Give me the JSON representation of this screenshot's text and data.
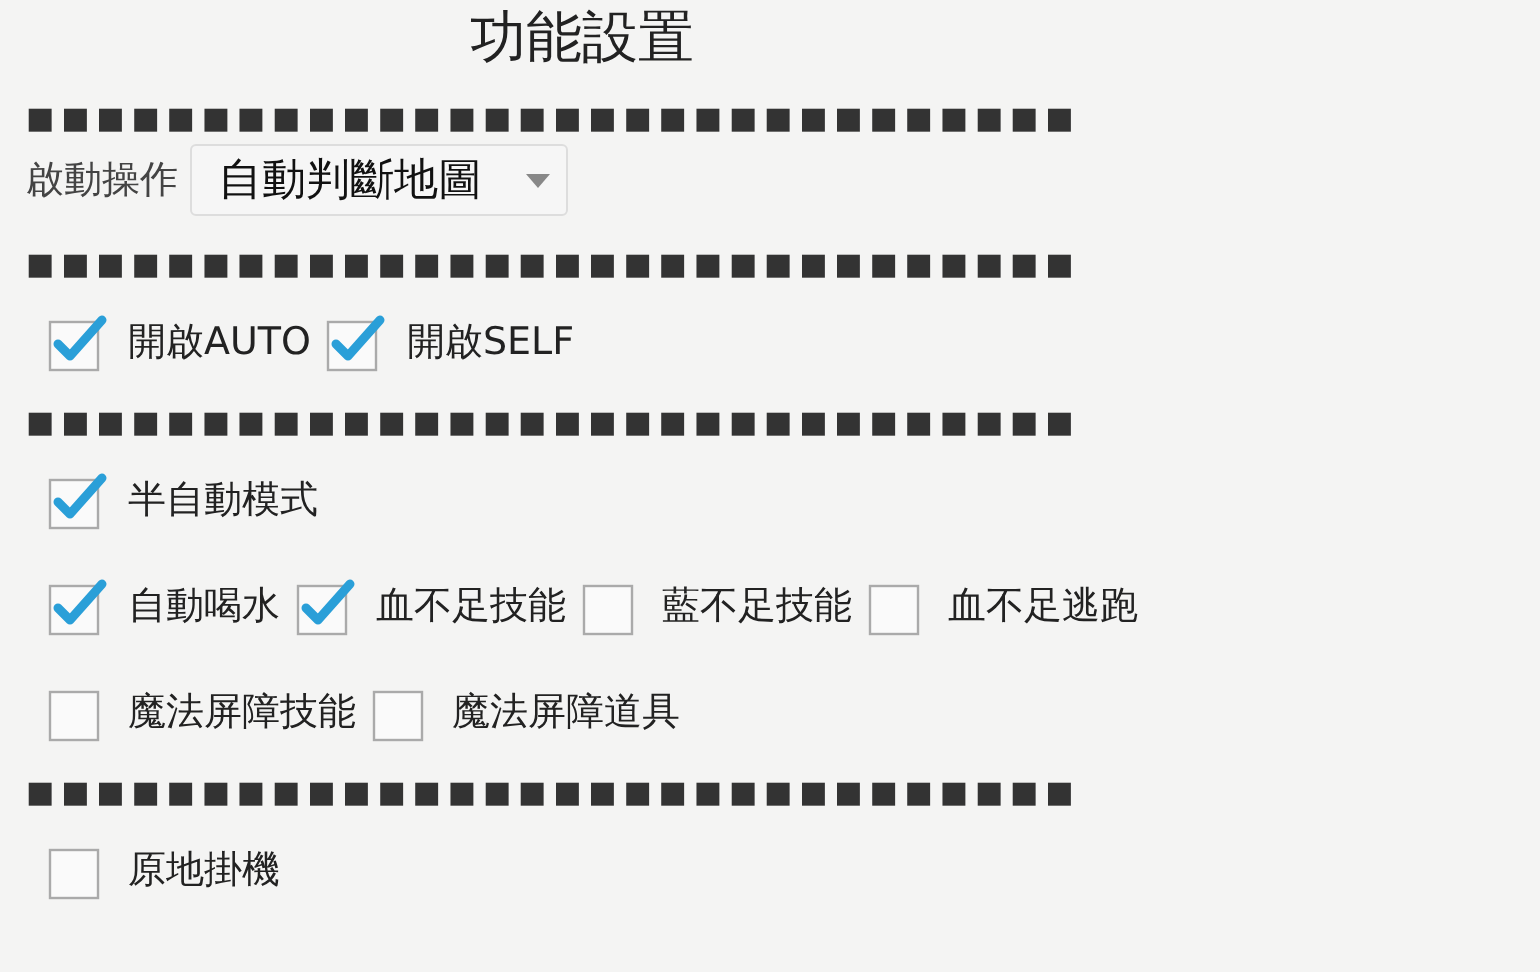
{
  "title": "功能設置",
  "items": [
    {
      "kind": "separator",
      "text": "■■■■■■■■■■■■■■■■■■■■■■■■■■■■■■"
    },
    {
      "kind": "dropdown",
      "label": "啟動操作",
      "value": "自動判斷地圖"
    },
    {
      "kind": "separator",
      "text": "■■■■■■■■■■■■■■■■■■■■■■■■■■■■■■"
    },
    {
      "kind": "checkboxes",
      "options": [
        {
          "label": "開啟AUTO",
          "checked": true
        },
        {
          "label": "開啟SELF",
          "checked": true
        }
      ]
    },
    {
      "kind": "separator",
      "text": "■■■■■■■■■■■■■■■■■■■■■■■■■■■■■■"
    },
    {
      "kind": "checkboxes",
      "options": [
        {
          "label": "半自動模式",
          "checked": true
        }
      ]
    },
    {
      "kind": "checkboxes",
      "options": [
        {
          "label": "自動喝水",
          "checked": true
        },
        {
          "label": "血不足技能",
          "checked": true
        },
        {
          "label": "藍不足技能",
          "checked": false
        },
        {
          "label": "血不足逃跑",
          "checked": false
        }
      ]
    },
    {
      "kind": "checkboxes",
      "options": [
        {
          "label": "魔法屏障技能",
          "checked": false
        },
        {
          "label": "魔法屏障道具",
          "checked": false
        }
      ]
    },
    {
      "kind": "separator",
      "text": "■■■■■■■■■■■■■■■■■■■■■■■■■■■■■■"
    },
    {
      "kind": "checkboxes",
      "options": [
        {
          "label": "原地掛機",
          "checked": false
        }
      ]
    }
  ]
}
